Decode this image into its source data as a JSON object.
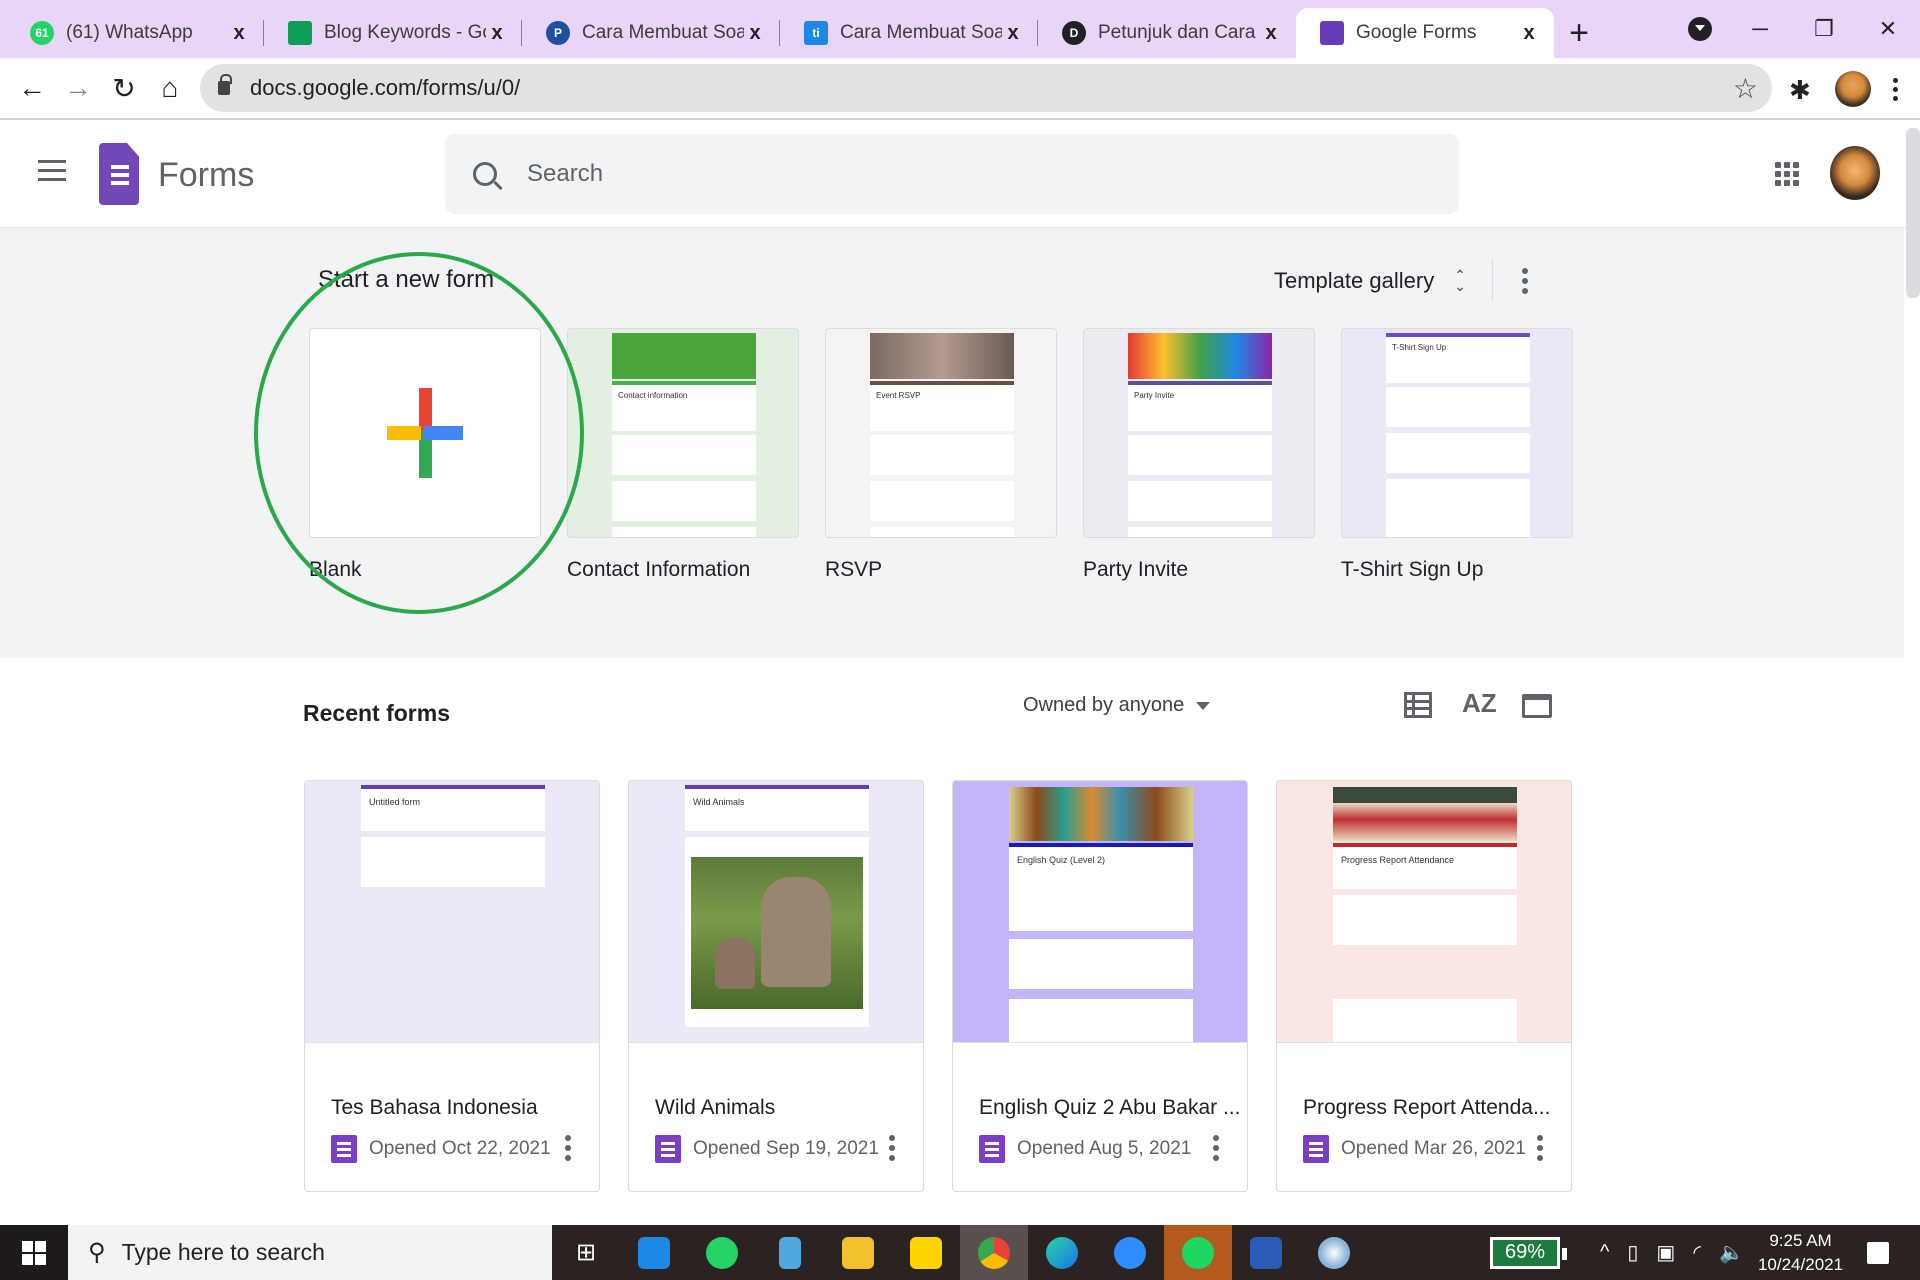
{
  "browser": {
    "tabs": [
      {
        "title": "(61) WhatsApp",
        "icon": "whatsapp-icon",
        "badge": "61",
        "color": "#25d366"
      },
      {
        "title": "Blog Keywords - Goog",
        "icon": "sheets-icon",
        "badge": "",
        "color": "#0f9d58"
      },
      {
        "title": "Cara Membuat Soal di",
        "icon": "p-site-icon",
        "badge": "P",
        "color": "#1e4fa3"
      },
      {
        "title": "Cara Membuat Soal O",
        "icon": "ti-site-icon",
        "badge": "ti",
        "color": "#1e88e5"
      },
      {
        "title": "Petunjuk dan Cara Me",
        "icon": "d-site-icon",
        "badge": "D",
        "color": "#202124"
      },
      {
        "title": "Google Forms",
        "icon": "forms-icon",
        "badge": "",
        "color": "#673ab7",
        "active": true
      }
    ],
    "close_glyph": "x",
    "new_tab_glyph": "+",
    "url": "docs.google.com/forms/u/0/",
    "window_controls": {
      "minimize": "─",
      "restore": "❐",
      "close": "✕"
    }
  },
  "app": {
    "name": "Forms",
    "search_placeholder": "Search"
  },
  "templates": {
    "heading": "Start a new form",
    "gallery_label": "Template gallery",
    "items": [
      {
        "label": "Blank"
      },
      {
        "label": "Contact Information",
        "thumb_title": "Contact information",
        "accent": "#4caf50",
        "bg": "#e3efe0"
      },
      {
        "label": "RSVP",
        "thumb_title": "Event RSVP",
        "accent": "#6d4c41",
        "bg": "#f5f3f3"
      },
      {
        "label": "Party Invite",
        "thumb_title": "Party Invite",
        "accent": "#5c5296",
        "bg": "#ecebf2"
      },
      {
        "label": "T-Shirt Sign Up",
        "thumb_title": "T-Shirt Sign Up",
        "accent": "#6a4fc4",
        "bg": "#ebe7f6"
      }
    ]
  },
  "recent": {
    "heading": "Recent forms",
    "owner_filter": "Owned by anyone",
    "forms": [
      {
        "name": "Tes Bahasa Indonesia",
        "opened": "Opened Oct 22, 2021",
        "thumb_title": "Untitled form",
        "bg": "#ede8f7",
        "accent": "#673ab7"
      },
      {
        "name": "Wild Animals",
        "opened": "Opened Sep 19, 2021",
        "thumb_title": "Wild Animals",
        "bg": "#ede8f7",
        "accent": "#673ab7"
      },
      {
        "name": "English Quiz 2 Abu Bakar ...",
        "opened": "Opened Aug 5, 2021",
        "thumb_title": "English Quiz (Level 2)",
        "bg": "#c3b5f7",
        "accent": "#1a1ab8"
      },
      {
        "name": "Progress Report Attenda...",
        "opened": "Opened Mar 26, 2021",
        "thumb_title": "Progress Report Attendance",
        "bg": "#fbe6e6",
        "accent": "#c62828"
      }
    ]
  },
  "taskbar": {
    "search_placeholder": "Type here to search",
    "battery": "69%",
    "time": "9:25 AM",
    "date": "10/24/2021"
  }
}
